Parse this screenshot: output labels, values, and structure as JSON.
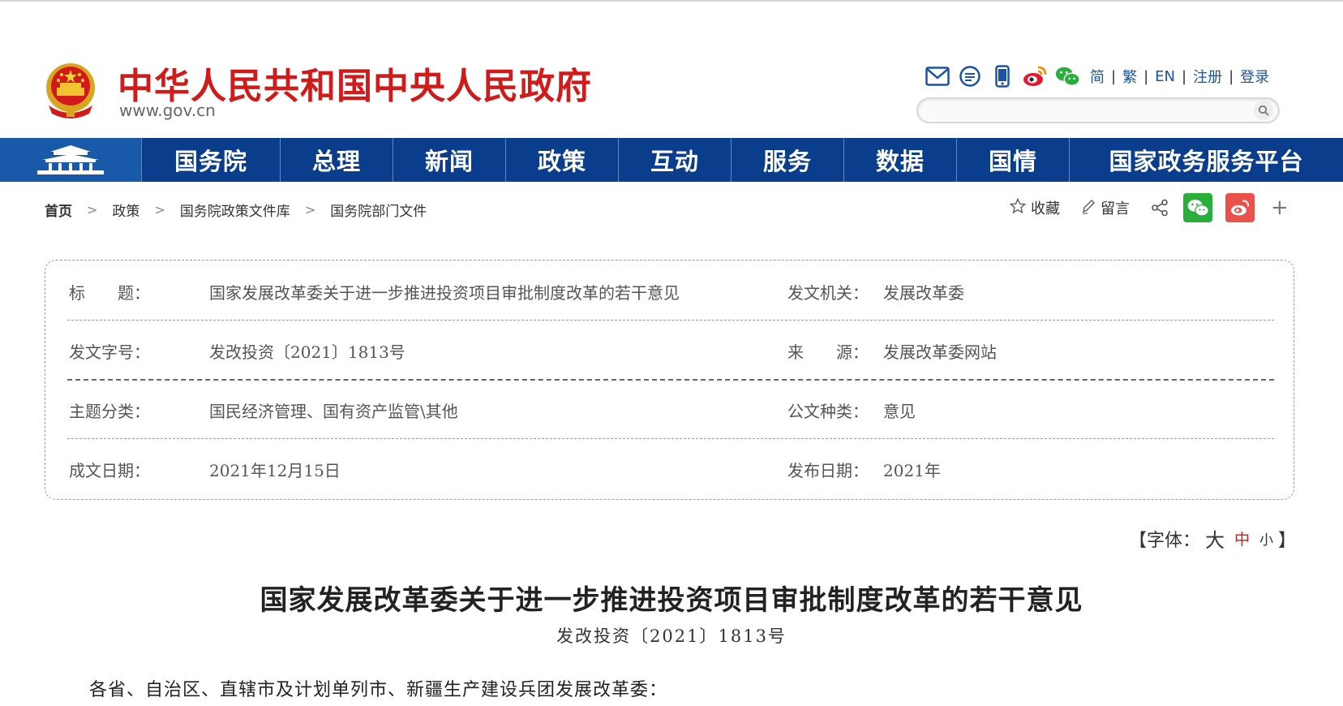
{
  "header": {
    "site_title": "中华人民共和国中央人民政府",
    "site_domain": "www.gov.cn",
    "util_icons": [
      "mail-icon",
      "chat-bubble-icon",
      "mobile-icon",
      "weibo-icon",
      "wechat-icon"
    ],
    "util_links": [
      "简",
      "繁",
      "EN",
      "注册",
      "登录"
    ],
    "search_placeholder": ""
  },
  "nav": {
    "items": [
      "国务院",
      "总理",
      "新闻",
      "政策",
      "互动",
      "服务",
      "数据",
      "国情",
      "国家政务服务平台"
    ]
  },
  "breadcrumb": [
    "首页",
    "政策",
    "国务院政策文件库",
    "国务院部门文件"
  ],
  "tools": {
    "favorite": "收藏",
    "comment": "留言"
  },
  "info": {
    "rows": [
      {
        "label1": "标　　题：",
        "value1": "国家发展改革委关于进一步推进投资项目审批制度改革的若干意见",
        "label2": "发文机关：",
        "value2": "发展改革委"
      },
      {
        "label1": "发文字号：",
        "value1": "发改投资〔2021〕1813号",
        "label2": "来　　源：",
        "value2": "发展改革委网站"
      },
      {
        "label1": "主题分类：",
        "value1": "国民经济管理、国有资产监管\\其他",
        "label2": "公文种类：",
        "value2": "意见"
      },
      {
        "label1": "成文日期：",
        "value1": "2021年12月15日",
        "label2": "发布日期：",
        "value2": "2021年"
      }
    ]
  },
  "fontsize": {
    "open": "【字体：",
    "big": "大",
    "mid": "中",
    "small": "小",
    "close": "】"
  },
  "article": {
    "title": "国家发展改革委关于进一步推进投资项目审批制度改革的若干意见",
    "doc_no": "发改投资〔2021〕1813号",
    "salutation": "各省、自治区、直辖市及计划单列市、新疆生产建设兵团发展改革委："
  },
  "colors": {
    "brand_red": "#d11a1a",
    "nav_blue": "#0a3e8c",
    "link_blue": "#1a54a4"
  }
}
